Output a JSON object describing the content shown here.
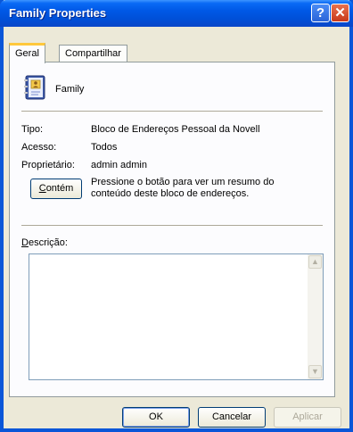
{
  "window": {
    "title": "Family Properties",
    "help_glyph": "?",
    "close_glyph": "✕"
  },
  "tabs": [
    {
      "label": "Geral"
    },
    {
      "label": "Compartilhar"
    }
  ],
  "book": {
    "name": "Family"
  },
  "details": {
    "tipo_label": "Tipo:",
    "tipo_value": "Bloco de Endereços Pessoal da Novell",
    "acesso_label": "Acesso:",
    "acesso_value": "Todos",
    "proprietario_label": "Proprietário:",
    "proprietario_value": "admin admin"
  },
  "contem": {
    "button_label_mnemonic": "C",
    "button_label_rest": "ontém",
    "description": "Pressione o botão para ver um resumo do conteúdo deste bloco de endereços."
  },
  "descricao": {
    "label_mnemonic": "D",
    "label_rest": "escrição:",
    "value": ""
  },
  "buttons": {
    "ok": "OK",
    "cancel": "Cancelar",
    "apply": "Aplicar"
  },
  "colors": {
    "titlebar": "#0058e6",
    "tab_active_accent": "#ffc83c",
    "dialog_bg": "#ece9d8"
  }
}
